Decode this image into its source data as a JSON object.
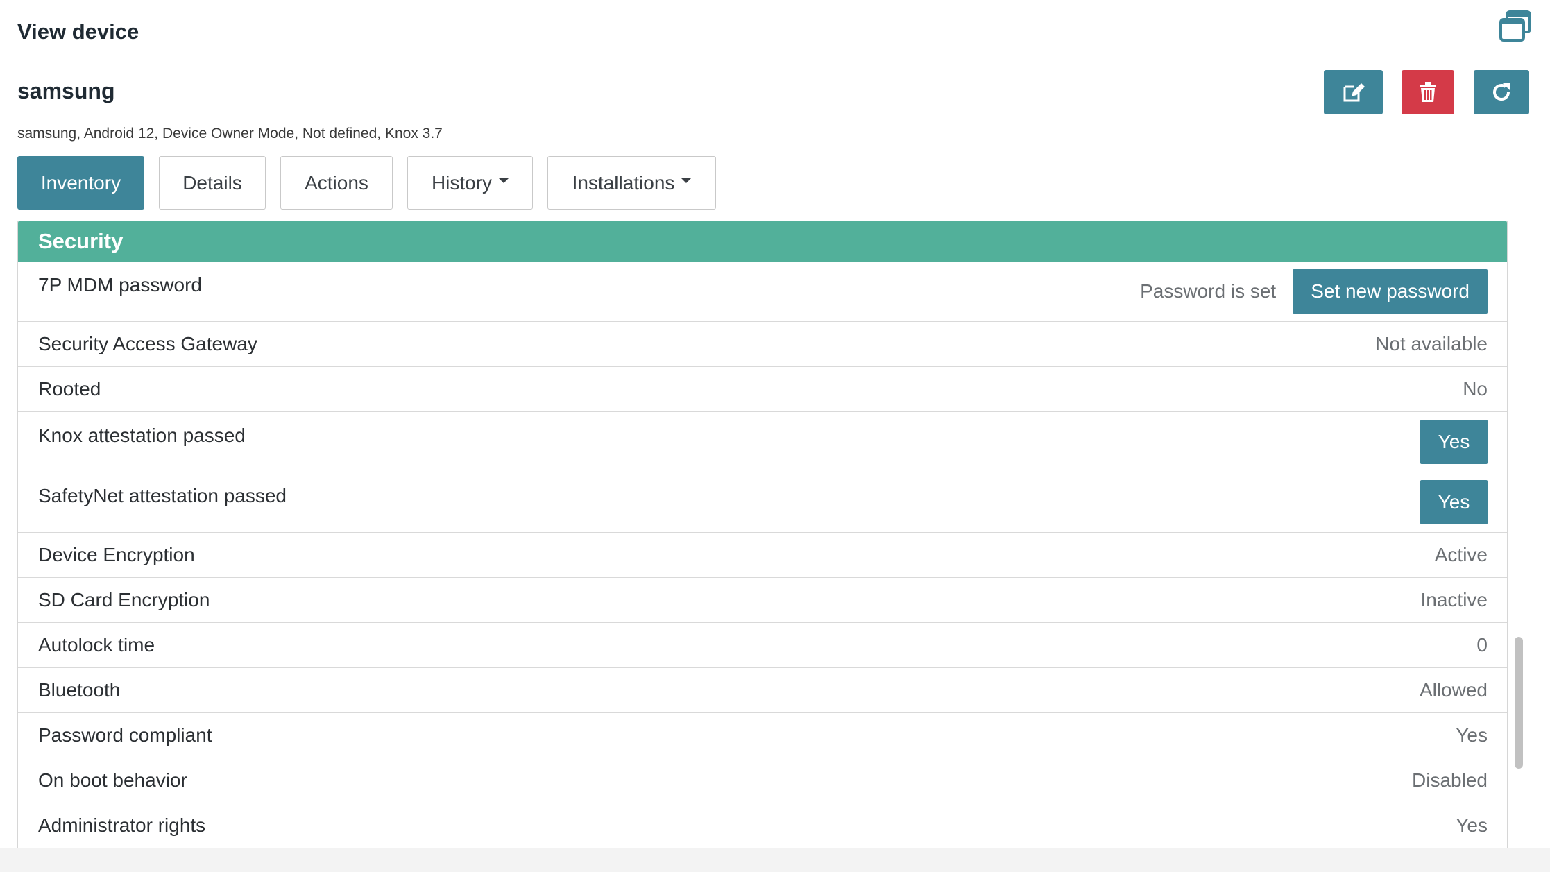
{
  "header": {
    "title": "View device",
    "window_icon": "restore-window-icon"
  },
  "device": {
    "name": "samsung",
    "subtitle": "samsung, Android 12, Device Owner Mode, Not defined, Knox 3.7"
  },
  "actions": {
    "edit_icon": "edit-icon",
    "delete_icon": "trash-icon",
    "refresh_icon": "refresh-icon"
  },
  "tabs": [
    {
      "label": "Inventory",
      "active": true,
      "dropdown": false
    },
    {
      "label": "Details",
      "active": false,
      "dropdown": false
    },
    {
      "label": "Actions",
      "active": false,
      "dropdown": false
    },
    {
      "label": "History",
      "active": false,
      "dropdown": true
    },
    {
      "label": "Installations",
      "active": false,
      "dropdown": true
    }
  ],
  "security": {
    "title": "Security",
    "mdm_password": {
      "label": "7P MDM password",
      "status": "Password is set",
      "button": "Set new password"
    },
    "rows": [
      {
        "label": "Security Access Gateway",
        "value": "Not available"
      },
      {
        "label": "Rooted",
        "value": "No"
      },
      {
        "label": "Knox attestation passed",
        "badge": "Yes"
      },
      {
        "label": "SafetyNet attestation passed",
        "badge": "Yes"
      },
      {
        "label": "Device Encryption",
        "value": "Active"
      },
      {
        "label": "SD Card Encryption",
        "value": "Inactive"
      },
      {
        "label": "Autolock time",
        "value": "0"
      },
      {
        "label": "Bluetooth",
        "value": "Allowed"
      },
      {
        "label": "Password compliant",
        "value": "Yes"
      },
      {
        "label": "On boot behavior",
        "value": "Disabled"
      },
      {
        "label": "Administrator rights",
        "value": "Yes"
      }
    ]
  },
  "colors": {
    "accent": "#3e8599",
    "danger": "#d43a48",
    "section_header": "#52b09a"
  }
}
